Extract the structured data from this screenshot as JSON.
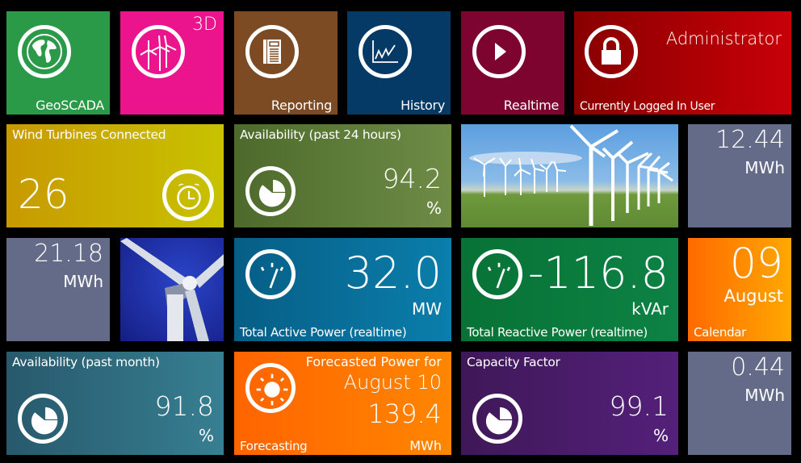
{
  "app": {
    "name": "Wind Farm SCADA Dashboard"
  },
  "colors": {
    "geoscada": "#2a9a48",
    "threeD": "#ec148c",
    "reporting": "#7c4b24",
    "history": "#053a66",
    "realtime": "#7e0430",
    "user": "#b00006",
    "turbines": "#cfae00",
    "availability24": "#5f7e3a",
    "energy_tile": "#646b88",
    "active_power": "#0a6e98",
    "reactive_power": "#0b7a3e",
    "calendar": "#ff7a00",
    "availability_month": "#2e6c80",
    "forecast": "#ff7000",
    "capacity": "#4b1c6c"
  },
  "nav": {
    "geoscada": {
      "label": "GeoSCADA",
      "icon": "globe-icon"
    },
    "threeD": {
      "label": "3D",
      "icon": "wind-turbines-icon"
    },
    "reporting": {
      "label": "Reporting",
      "icon": "report-document-icon"
    },
    "history": {
      "label": "History",
      "icon": "line-chart-icon"
    },
    "realtime": {
      "label": "Realtime",
      "icon": "play-icon"
    }
  },
  "user": {
    "name": "Administrator",
    "caption": "Currently Logged In User",
    "icon": "lock-icon"
  },
  "turbines": {
    "title": "Wind Turbines Connected",
    "value": "26",
    "icon": "alarm-clock-icon"
  },
  "availability24": {
    "title": "Availability (past 24 hours)",
    "value": "94.2",
    "unit": "%",
    "icon": "pie-chart-icon"
  },
  "energy1": {
    "value": "12.44",
    "unit": "MWh"
  },
  "energy2": {
    "value": "21.18",
    "unit": "MWh"
  },
  "energy3": {
    "value": "0.44",
    "unit": "MWh"
  },
  "photos": {
    "wind_farm": "wind-farm-photo",
    "turbine_closeup": "turbine-closeup-photo"
  },
  "active_power": {
    "value": "32.0",
    "unit": "MW",
    "caption": "Total Active Power (realtime)",
    "icon": "gauge-icon"
  },
  "reactive_power": {
    "value": "-116.8",
    "unit": "kVAr",
    "caption": "Total Reactive Power (realtime)",
    "icon": "gauge-icon"
  },
  "calendar": {
    "day": "09",
    "month": "August",
    "caption": "Calendar"
  },
  "availability_month": {
    "title": "Availability (past month)",
    "value": "91.8",
    "unit": "%",
    "icon": "pie-chart-icon"
  },
  "forecast": {
    "title": "Forecasted Power for",
    "date": "August 10",
    "value": "139.4",
    "unit": "MWh",
    "caption": "Forecasting",
    "icon": "sun-icon"
  },
  "capacity": {
    "title": "Capacity Factor",
    "value": "99.1",
    "unit": "%",
    "icon": "pie-chart-icon"
  }
}
